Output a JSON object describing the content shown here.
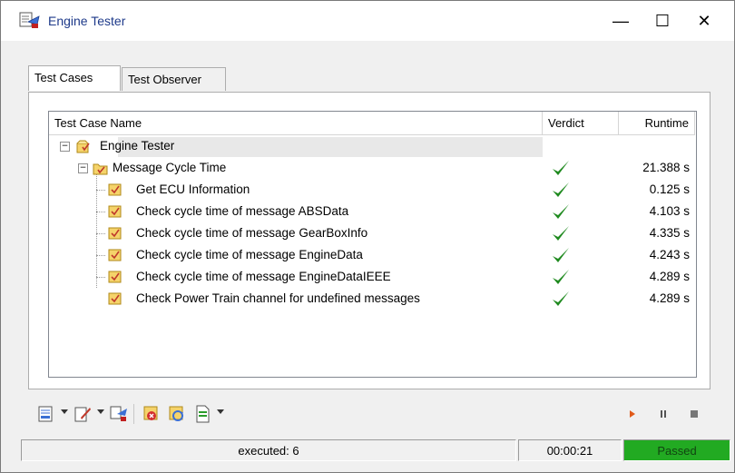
{
  "window": {
    "title": "Engine Tester",
    "minimize": "—",
    "maximize": "☐",
    "close": "✕"
  },
  "tabs": [
    {
      "label": "Test Cases",
      "active": true
    },
    {
      "label": "Test Observer",
      "active": false
    }
  ],
  "columns": {
    "name": "Test Case Name",
    "verdict": "Verdict",
    "runtime": "Runtime"
  },
  "tree": {
    "root": {
      "label": "Engine Tester",
      "expander": "−"
    },
    "group": {
      "label": "Message Cycle Time",
      "expander": "−",
      "verdict": "passed",
      "runtime": "21.388 s"
    },
    "cases": [
      {
        "label": "Get ECU Information",
        "verdict": "passed",
        "runtime": "0.125 s"
      },
      {
        "label": "Check cycle time of message ABSData",
        "verdict": "passed",
        "runtime": "4.103 s"
      },
      {
        "label": "Check cycle time of message GearBoxInfo",
        "verdict": "passed",
        "runtime": "4.335 s"
      },
      {
        "label": "Check cycle time of message EngineData",
        "verdict": "passed",
        "runtime": "4.243 s"
      },
      {
        "label": "Check cycle time of message EngineDataIEEE",
        "verdict": "passed",
        "runtime": "4.289 s"
      },
      {
        "label": "Check Power Train channel for undefined messages",
        "verdict": "passed",
        "runtime": "4.289 s"
      }
    ]
  },
  "toolbar": {
    "left": [
      "report-icon",
      "edit-icon",
      "tester-icon",
      "stop-test-icon",
      "refresh-icon",
      "document-icon"
    ],
    "right": [
      "play-icon",
      "pause-icon",
      "stop-icon"
    ]
  },
  "status": {
    "executed": "executed: 6",
    "elapsed": "00:00:21",
    "verdict": "Passed"
  },
  "colors": {
    "passed_bg": "#22aa22",
    "check": "#1f8a1f",
    "title": "#1e3a8a",
    "play": "#e05a1a"
  }
}
